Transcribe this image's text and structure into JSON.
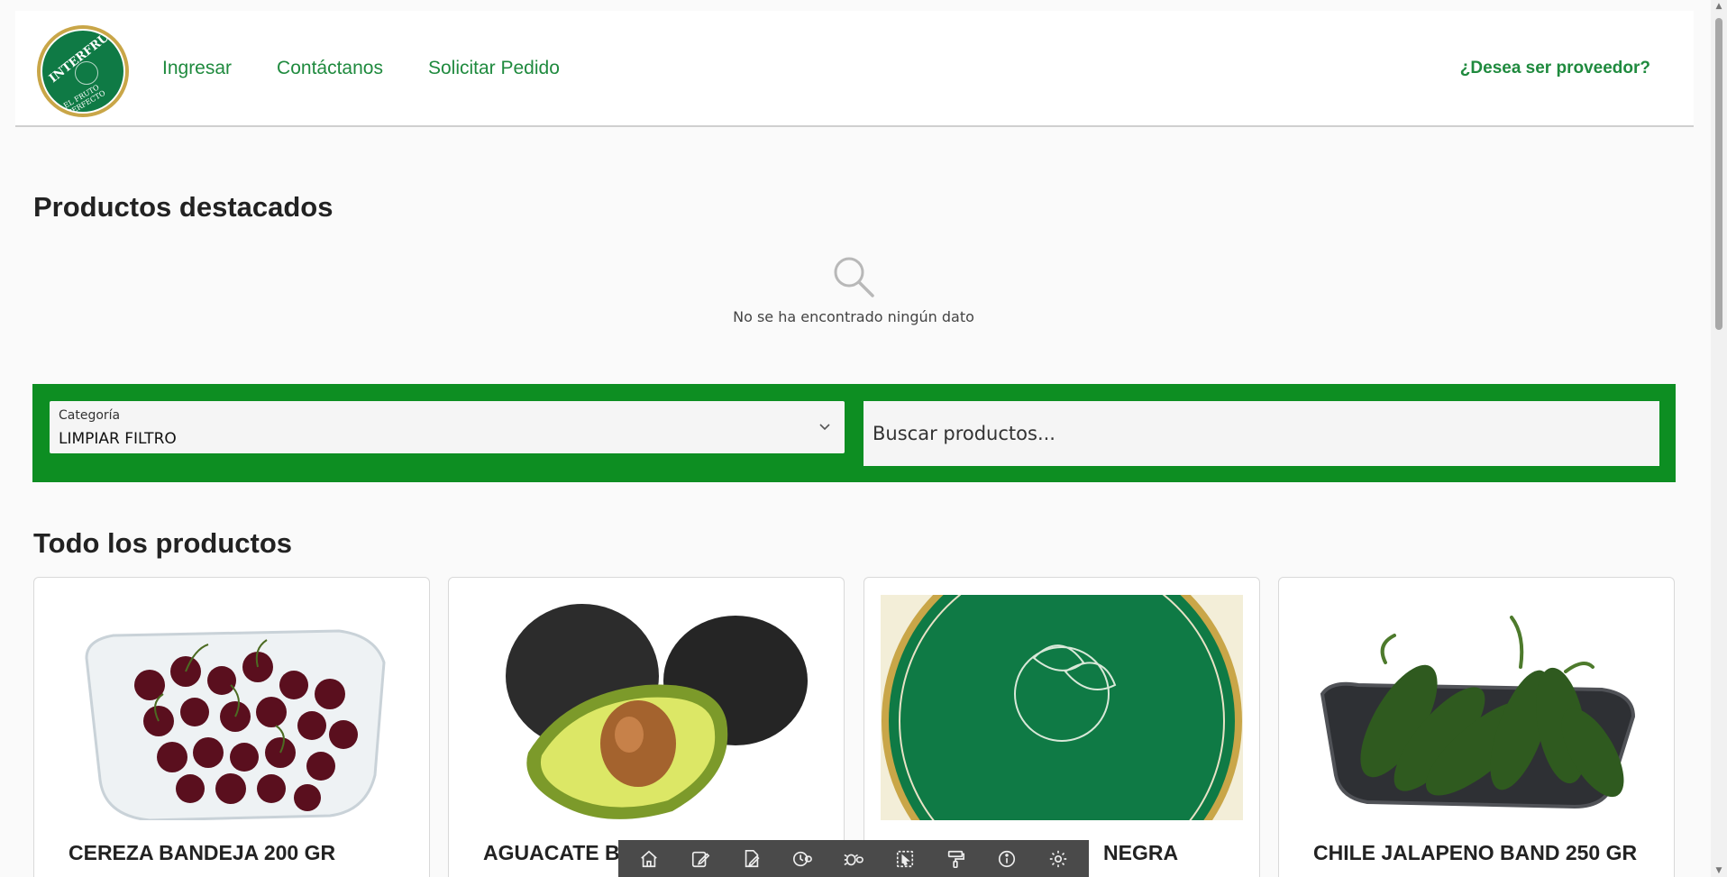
{
  "header": {
    "logo": {
      "name": "interfrutd-logo",
      "brand_text": "INTERFRUTD",
      "tagline": "EL FRUTO PERFECTO"
    },
    "nav": [
      {
        "label": "Ingresar"
      },
      {
        "label": "Contáctanos"
      },
      {
        "label": "Solicitar Pedido"
      }
    ],
    "provider_link": "¿Desea ser proveedor?"
  },
  "featured": {
    "title": "Productos destacados",
    "empty_text": "No se ha encontrado ningún dato",
    "empty_icon": "search-icon"
  },
  "filters": {
    "category_label": "Categoría",
    "category_value": "LIMPIAR FILTRO",
    "search_placeholder": "Buscar productos..."
  },
  "all_products": {
    "title": "Todo los productos",
    "items": [
      {
        "name": "CEREZA BANDEJA 200 GR",
        "image": "cherries-image"
      },
      {
        "name": "AGUACATE BA",
        "image": "avocado-image"
      },
      {
        "name": "NEGRA",
        "image": "interfrutd-logo-image"
      },
      {
        "name": "CHILE JALAPENO BAND 250 GR",
        "image": "jalapeno-image"
      }
    ]
  },
  "toolbar": {
    "icons": [
      "home-icon",
      "edit-icon",
      "page-edit-icon",
      "history-icon",
      "bug-icon",
      "select-icon",
      "paint-icon",
      "info-icon",
      "settings-icon"
    ]
  },
  "colors": {
    "brand_green": "#1f8a3e",
    "filter_bar_green": "#0d8e22",
    "logo_green": "#0f7a45",
    "logo_gold": "#c9a648"
  }
}
